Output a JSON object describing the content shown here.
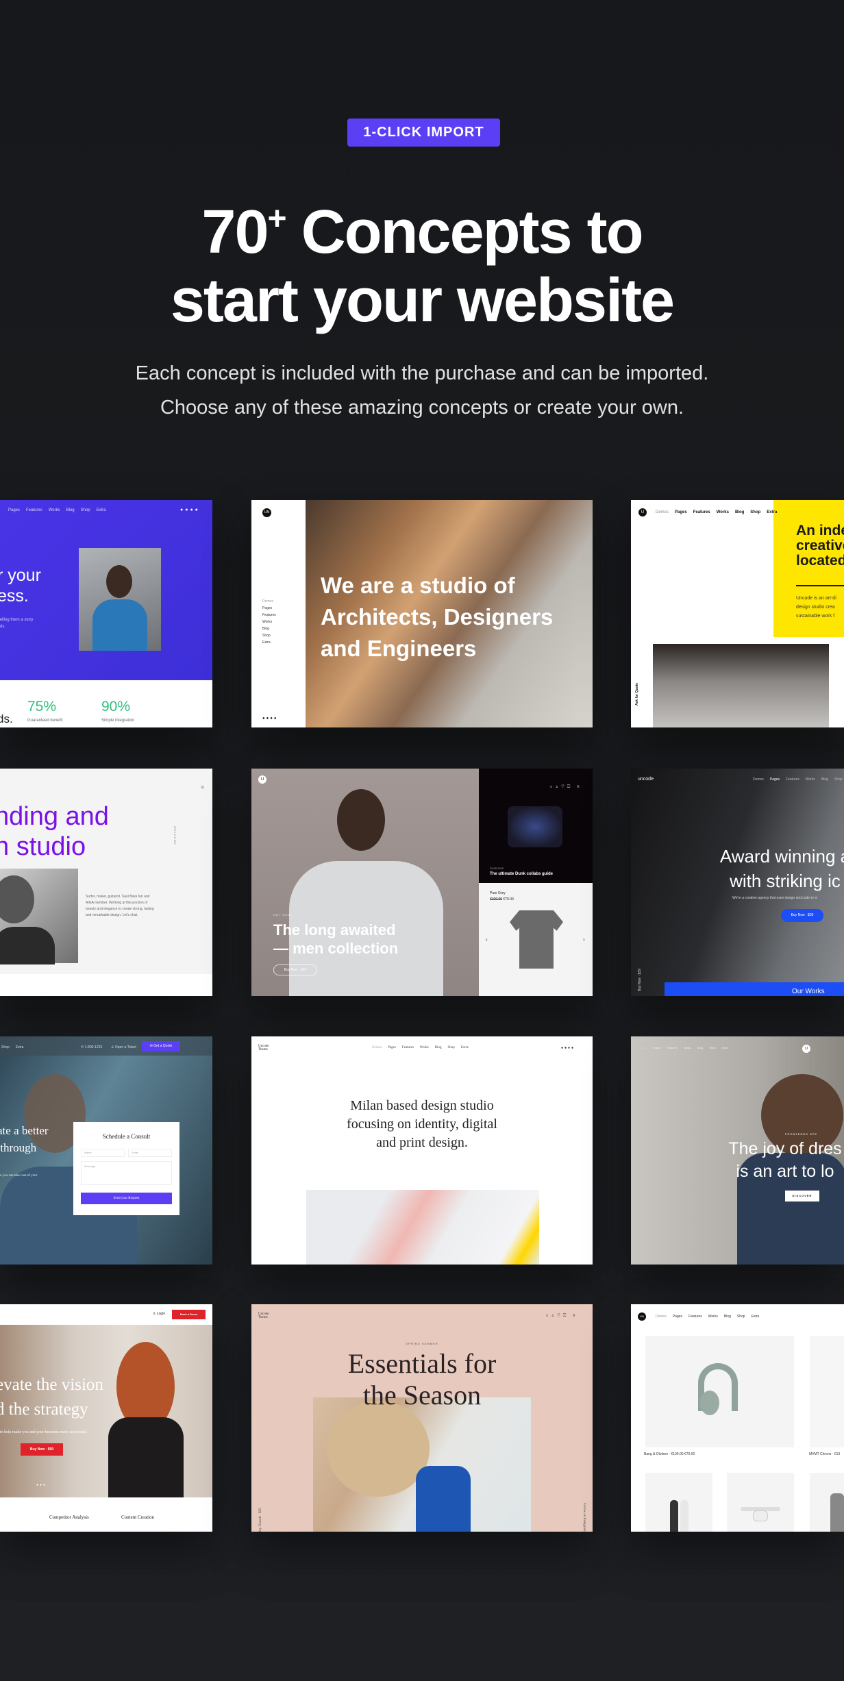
{
  "hero": {
    "badge": "1-CLICK IMPORT",
    "title_number": "70",
    "title_sup": "+",
    "title_line1_rest": " Concepts to",
    "title_line2": "start your website",
    "subtitle_line1": "Each concept is included with the purchase and can be imported.",
    "subtitle_line2": "Choose any of these amazing concepts or create your own."
  },
  "colors": {
    "background": "#17181b",
    "accent": "#5b3ff5"
  },
  "nav_common": [
    "Demos",
    "Pages",
    "Features",
    "Works",
    "Blog",
    "Shop",
    "Extra"
  ],
  "concepts": [
    {
      "id": "startup",
      "nav": [
        "Pages",
        "Features",
        "Works",
        "Blog",
        "Shop",
        "Extra"
      ],
      "headline": "r your\ness.",
      "body": "telling them a story\nrds.",
      "stats": [
        {
          "value": "75%",
          "label": "Guaranteed benefit"
        },
        {
          "value": "90%",
          "label": "Simple integration"
        }
      ],
      "trailing": "ds."
    },
    {
      "id": "architects",
      "logo": "UN",
      "menu": [
        "Demos",
        "Pages",
        "Features",
        "Works",
        "Blog",
        "Shop",
        "Extra"
      ],
      "headline": "We are a studio of Architects, Designers and Engineers"
    },
    {
      "id": "creative-yellow",
      "logo": "U",
      "nav": [
        "Demos",
        "Pages",
        "Features",
        "Works",
        "Blog",
        "Shop",
        "Extra"
      ],
      "headline": "An inde\ncreative\nlocated",
      "body": "Uncode is an art-di\ndesign studio crea\nsustainable work f",
      "side_label": "Ask for Quote"
    },
    {
      "id": "branding-studio",
      "headline": "nding and\nn studio",
      "side_label": "WELCOME",
      "body": "Surfer, maker, guitarist. Saul Bass fan and AIGA member. Working at the junction of beauty and elegance to create strong, lasting and remarkable design. Let's chat."
    },
    {
      "id": "fashion-men",
      "logo": "U",
      "eyebrow": "OUT NOW",
      "headline": "The long awaited\n— men collection",
      "button": "Buy Now · $59",
      "article_date": "25.05.2020",
      "article_title": "The ultimate Dunk collabs guide",
      "product_name": "Pure Grey",
      "product_old_price": "€100.00",
      "product_price": "€70.00"
    },
    {
      "id": "agency-dark",
      "logo": "uncode",
      "nav": [
        "Demos",
        "Pages",
        "Features",
        "Works",
        "Blog",
        "Shop"
      ],
      "headline": "Award winning a\nwith striking ic",
      "body": "We're a creative agency that uses design and code to st",
      "button": "Buy Now · $39",
      "side_label": "Buy Now · $39",
      "section": "Our Works"
    },
    {
      "id": "consulting",
      "nav": [
        "Shop",
        "Extra"
      ],
      "phone": "1-800-1223",
      "ticket": "Open a Ticket",
      "cta": "Get a Quote",
      "headline": "ate a better\n through",
      "body": "o you can take care of your",
      "form_title": "Schedule a Consult",
      "form_name": "Name",
      "form_email": "Email",
      "form_message": "Message",
      "form_button": "Send your Request"
    },
    {
      "id": "milan-studio",
      "logo": "Uncode\nTheme",
      "nav": [
        "Demos",
        "Pages",
        "Features",
        "Works",
        "Blog",
        "Shop",
        "Extra"
      ],
      "headline": "Milan based design studio\nfocusing on identity, digital\nand print design."
    },
    {
      "id": "joy-of-dressing",
      "nav": [
        "Demos",
        "Pages",
        "Features",
        "Works",
        "Blog",
        "Shop",
        "Extra"
      ],
      "logo": "U",
      "eyebrow": "FRONTENDS SPE",
      "headline": "The joy of dres\nis an art to lo",
      "button": "DISCOVER"
    },
    {
      "id": "business-vision",
      "login": "Login",
      "cta": "Book a Demo",
      "headline": "evate the vision\nd the strategy",
      "body": "to help make you and your business more successful.",
      "button": "Buy Now · $59",
      "services": [
        "Competitor Analysis",
        "Content Creation"
      ]
    },
    {
      "id": "essentials-season",
      "logo": "Uncode\nTheme",
      "eyebrow": "SPRING SUMMER",
      "headline": "Essentials for\nthe Season",
      "side_left": "Buy Uncode · $59",
      "side_right": "Follow on Instagram"
    },
    {
      "id": "shop-minimal",
      "logo": "UN",
      "nav": [
        "Demos",
        "Pages",
        "Features",
        "Works",
        "Blog",
        "Shop",
        "Extra"
      ],
      "product1": "Bang & Olufsen - €100.00 €70.00",
      "product2": "MVMT Chrono - €13"
    }
  ]
}
